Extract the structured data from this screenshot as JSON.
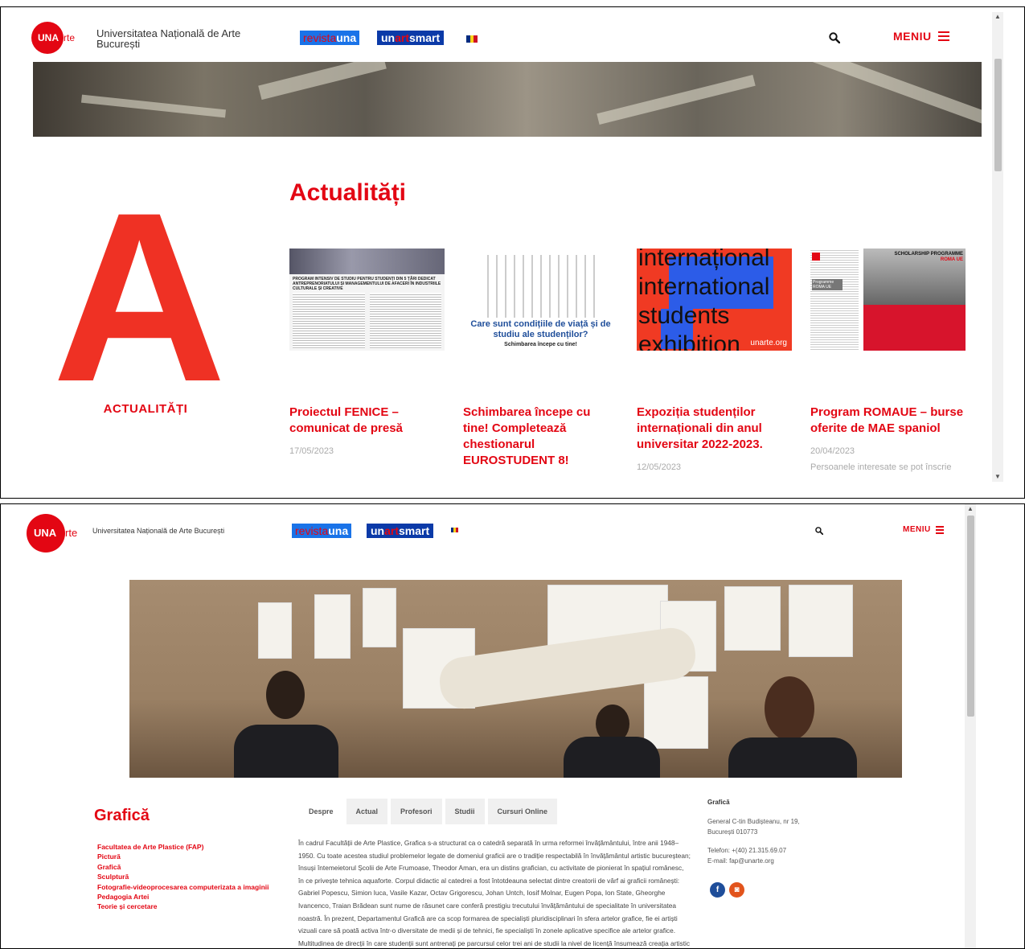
{
  "brand": {
    "logo_una": "UNA",
    "logo_rte": "rte",
    "site_title": "Universitatea Națională de Arte București",
    "revista_a": "revista",
    "revista_b": "una",
    "unart_a": "un",
    "unart_b": "art",
    "unart_c": "smart",
    "menu_label": "MENIU",
    "flag_colors": [
      "#002b7f",
      "#fcd116",
      "#ce1126"
    ],
    "accent": "#e30613"
  },
  "news": {
    "big_letter": "A",
    "section_label": "ACTUALITĂȚI",
    "title": "Actualități",
    "items": [
      {
        "title": "Proiectul FENICE – comunicat de presă",
        "date": "17/05/2023",
        "excerpt": ""
      },
      {
        "title": "Schimbarea începe cu tine! Completează chestionarul EUROSTUDENT 8!",
        "date": "",
        "excerpt": ""
      },
      {
        "title": "Expoziția studenților internaționali din anul universitar 2022-2023.",
        "date": "12/05/2023",
        "excerpt": ""
      },
      {
        "title": "Program ROMAUE – burse oferite de MAE spaniol",
        "date": "20/04/2023",
        "excerpt": "Persoanele interesate se pot înscrie"
      }
    ],
    "thumb1": {
      "heading": "PROGRAM INTENSIV DE STUDIU PENTRU STUDENȚI DIN 5 ȚĂRI DEDICAT ANTREPRENORIATULUI ȘI MANAGEMENTULUI DE AFACERI ÎN INDUSTRIILE CULTURALE ȘI CREATIVE"
    },
    "thumb2": {
      "question": "Care sunt condițiile de viață și de studiu ale studenților?",
      "sub": "Schimbarea începe cu tine!"
    },
    "thumb3": {
      "line1": "internațional",
      "line2": "international",
      "line3": "students",
      "line4": "exhibition",
      "tag": "unarte.org"
    },
    "thumb4": {
      "label_a": "SCHOLARSHIP PROGRAMME",
      "label_b": "ROMA UE",
      "prog": "Programme ROMA UE"
    }
  },
  "dept": {
    "title": "Grafică",
    "links": [
      "Facultatea de Arte Plastice (FAP)",
      "Pictură",
      "Grafică",
      "Sculptură",
      "Fotografie-videoprocesarea computerizata a imaginii",
      "Pedagogia Artei",
      "Teorie și cercetare"
    ],
    "tabs": [
      "Despre",
      "Actual",
      "Profesori",
      "Studii",
      "Cursuri Online"
    ],
    "body": "În cadrul Facultății de Arte Plastice, Grafica s-a structurat ca o catedră separată în urma reformei învățământului, între anii 1948–1950. Cu toate acestea studiul problemelor legate de domeniul graficii are o tradiție respectabilă în învățământul artistic bucureștean; însuși întemeietorul Școlii de Arte Frumoase, Theodor Aman, era un distins grafician, cu activitate de pionierat în spațiul românesc, în ce privește tehnica aquaforte. Corpul didactic al catedrei a fost întotdeauna selectat dintre creatorii de vârf ai graficii românești: Gabriel Popescu, Simion Iuca, Vasile Kazar, Octav Grigorescu, Johan Untch, Iosif Molnar, Eugen Popa, Ion State, Gheorghe Ivancenco, Traian Brădean sunt nume de răsunet care conferă prestigiu trecutului învățământului de specialitate în universitatea noastră. În prezent, Departamentul Grafică are ca scop formarea de specialiști pluridisciplinari în sfera artelor grafice, fie ei artiști vizuali care să poată activa într-o diversitate de medii și de tehnici, fie specialiști în zonele aplicative specifice ale artelor grafice. Multitudinea de direcții în care studenții sunt antrenați pe parcursul celor trei ani de studii la nivel de licență însumează creația artistic autonomă din zona artelor grafice,",
    "contact": {
      "title": "Grafică",
      "address1": "General C-tin Budișteanu, nr 19,",
      "address2": "București 010773",
      "phone": "Telefon: +(40) 21.315.69.07",
      "email": "E-mail: fap@unarte.org"
    },
    "social": [
      "facebook",
      "instagram"
    ]
  }
}
